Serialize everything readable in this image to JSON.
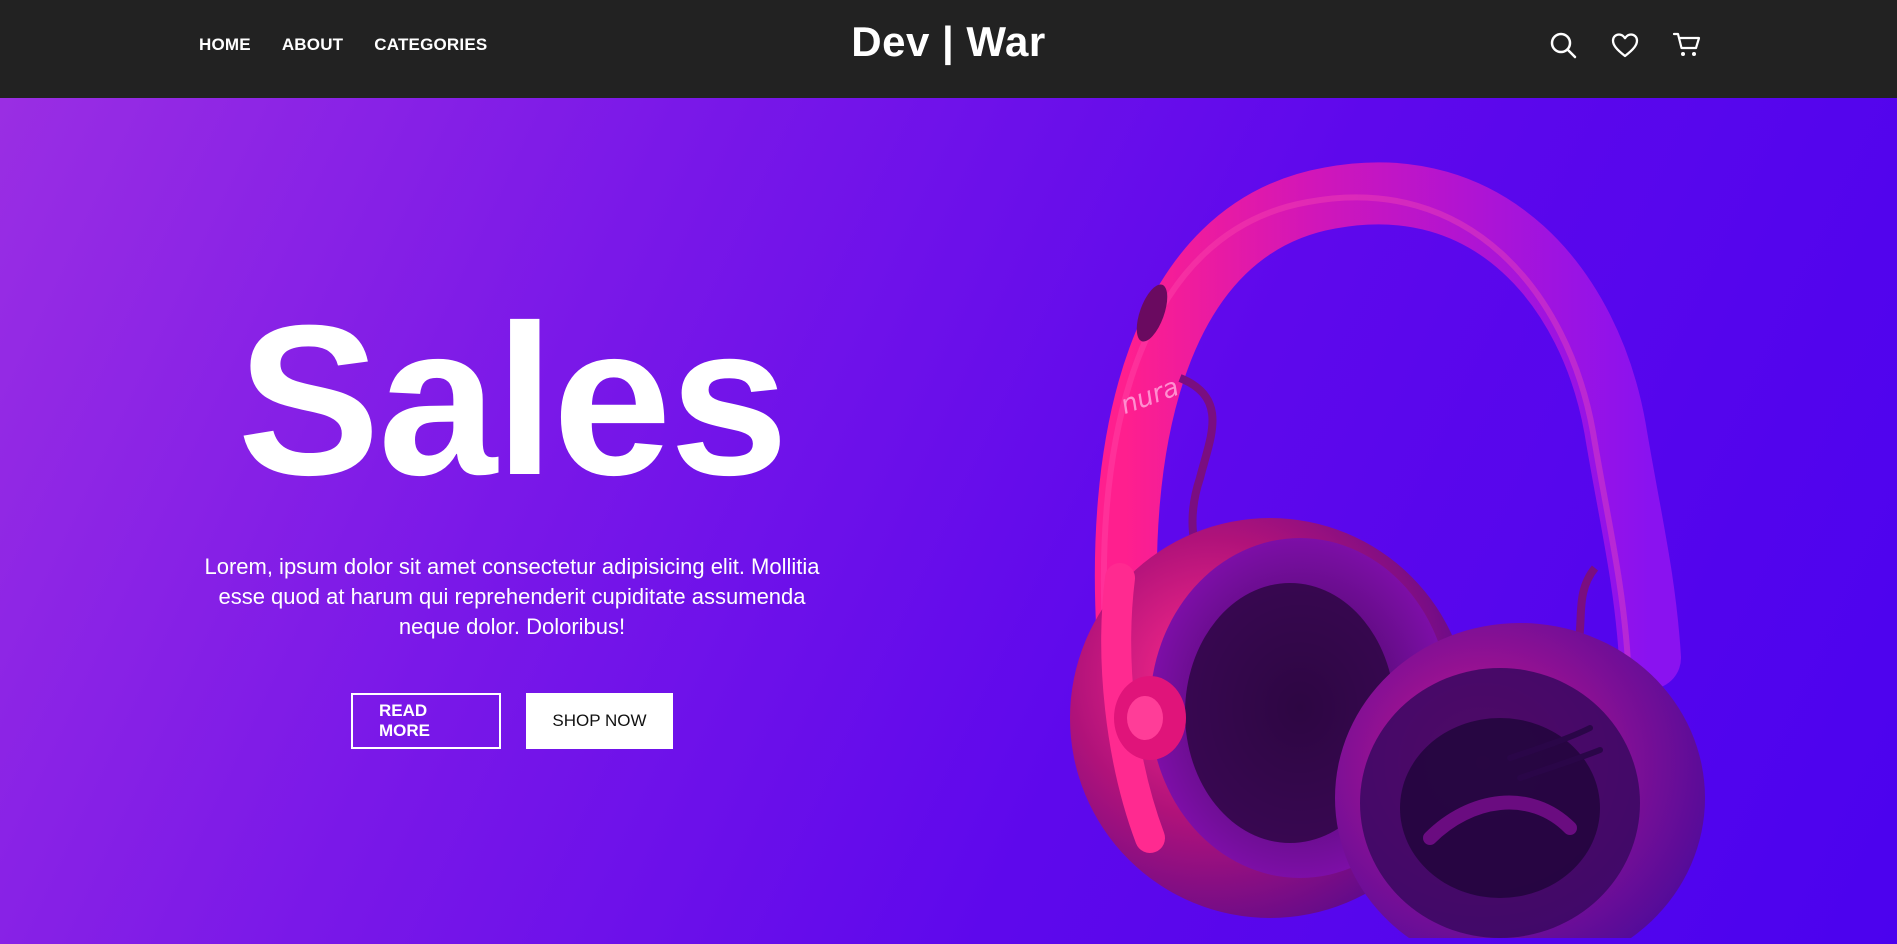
{
  "nav": {
    "links": [
      "HOME",
      "ABOUT",
      "CATEGORIES"
    ],
    "brand": "Dev | War",
    "icons": [
      "search-icon",
      "heart-icon",
      "cart-icon"
    ]
  },
  "hero": {
    "title": "Sales",
    "text": "Lorem, ipsum dolor sit amet consectetur adipisicing elit. Mollitia esse quod at harum qui reprehenderit cupiditate assumenda neque dolor. Doloribus!",
    "buttons": {
      "read_more": "READ MORE",
      "shop_now": "SHOP NOW"
    },
    "product_brand": "nura"
  },
  "colors": {
    "navbar": "#222222",
    "gradient_start": "#9a2ee3",
    "gradient_end": "#4b02ee",
    "headphone_pink": "#ff1f8e",
    "headphone_purple": "#8a12f0"
  }
}
